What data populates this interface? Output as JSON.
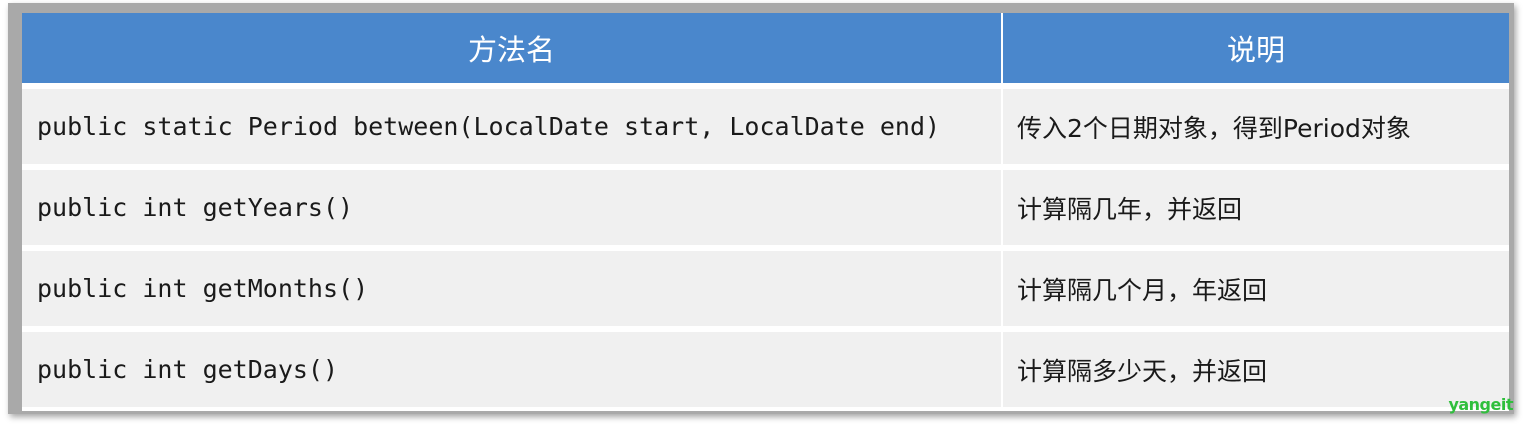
{
  "table": {
    "headers": [
      "方法名",
      "说明"
    ],
    "rows": [
      {
        "method": "public static Period between(LocalDate start, LocalDate end)",
        "description": "传入2个日期对象，得到Period对象"
      },
      {
        "method": "public int getYears()",
        "description": "计算隔几年，并返回"
      },
      {
        "method": "public int getMonths()",
        "description": "计算隔几个月，年返回"
      },
      {
        "method": "public int getDays()",
        "description": "计算隔多少天，并返回"
      }
    ]
  },
  "watermark": "yangeit",
  "colors": {
    "header_bg": "#4a87cc",
    "row_bg": "#f0f0f0",
    "watermark": "#2fbf3c"
  }
}
